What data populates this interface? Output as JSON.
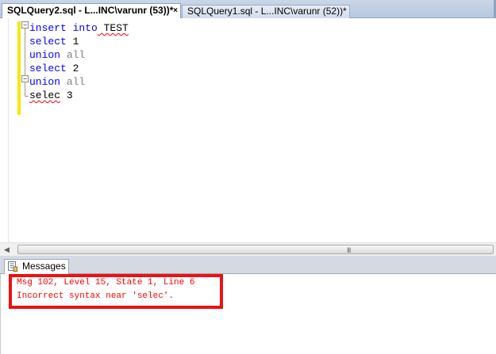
{
  "tabs": [
    {
      "label": "SQLQuery2.sql - L...INC\\varunr (53))*",
      "active": true
    },
    {
      "label": "SQLQuery1.sql - L...INC\\varunr (52))*",
      "active": false
    }
  ],
  "tab_close_glyph": "×",
  "editor": {
    "lines": [
      {
        "kw": "insert into",
        "rest": " TEST"
      },
      {
        "kw": "select",
        "rest": " 1"
      },
      {
        "kw": "union",
        "gray": " all"
      },
      {
        "kw": "select",
        "rest": " 2"
      },
      {
        "kw": "union",
        "gray": " all"
      },
      {
        "err": "selec",
        "rest": " 3"
      }
    ]
  },
  "scrollbar": {
    "grip": "III",
    "left_arrow": "◀"
  },
  "results": {
    "tab_label": "Messages",
    "messages": [
      "Msg 102, Level 15, State 1, Line 6",
      "Incorrect syntax near 'selec'."
    ]
  },
  "colors": {
    "keyword": "#0000ff",
    "error_text": "#ff0000",
    "highlight_box": "#ee1111",
    "change_bar": "#f4e700"
  },
  "icons": [
    "close-icon",
    "collapse-icon",
    "messages-icon",
    "scroll-left-icon",
    "scroll-grip-icon"
  ]
}
